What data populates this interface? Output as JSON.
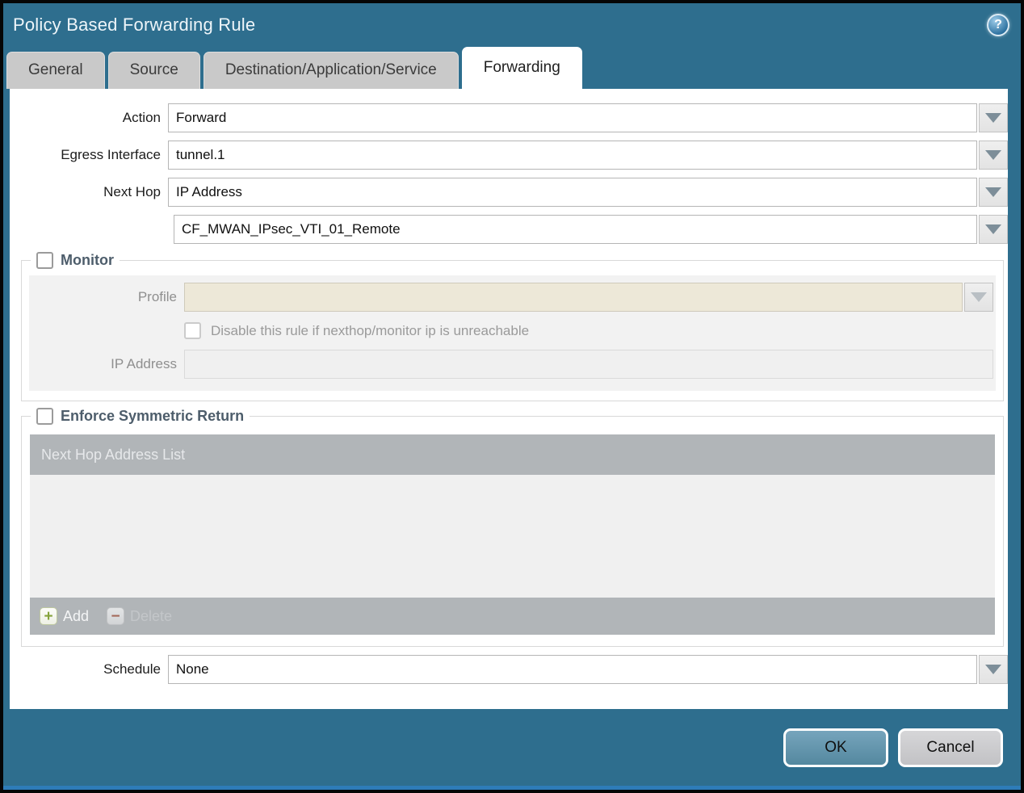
{
  "window": {
    "title": "Policy Based Forwarding Rule"
  },
  "icons": {
    "help": "?",
    "add": "+",
    "delete": "−"
  },
  "tabs": [
    {
      "label": "General",
      "active": false
    },
    {
      "label": "Source",
      "active": false
    },
    {
      "label": "Destination/Application/Service",
      "active": false
    },
    {
      "label": "Forwarding",
      "active": true
    }
  ],
  "form": {
    "action": {
      "label": "Action",
      "value": "Forward"
    },
    "egress_interface": {
      "label": "Egress Interface",
      "value": "tunnel.1"
    },
    "next_hop": {
      "label": "Next Hop",
      "value": "IP Address"
    },
    "next_hop_address": {
      "value": "CF_MWAN_IPsec_VTI_01_Remote"
    },
    "schedule": {
      "label": "Schedule",
      "value": "None"
    }
  },
  "monitor": {
    "legend": "Monitor",
    "checked": false,
    "profile": {
      "label": "Profile",
      "value": ""
    },
    "disable_rule_label": "Disable this rule if nexthop/monitor ip is unreachable",
    "disable_rule_checked": false,
    "ip_address": {
      "label": "IP Address",
      "value": ""
    }
  },
  "symmetric_return": {
    "legend": "Enforce Symmetric Return",
    "checked": false,
    "list_header": "Next Hop Address List",
    "rows": [],
    "add_label": "Add",
    "delete_label": "Delete"
  },
  "footer": {
    "ok_label": "OK",
    "cancel_label": "Cancel"
  },
  "colors": {
    "chrome_teal": "#2e6e8e",
    "tab_inactive_gray": "#c9c9c9",
    "section_legend": "#4d5d6b",
    "disabled_beige": "#ede8d8",
    "table_gray": "#b1b5b8",
    "add_green": "#85a33c",
    "delete_red": "#a4695a",
    "ok_blue": "#5e94ae",
    "bottom_strip_blue": "#2e7cb8"
  }
}
